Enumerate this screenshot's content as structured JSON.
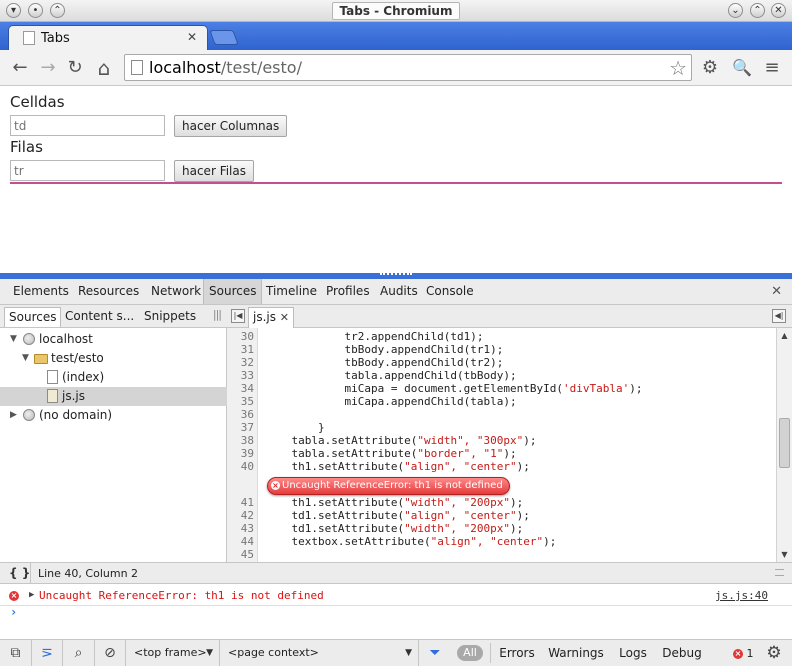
{
  "window": {
    "title": "Tabs - Chromium"
  },
  "tabs": [
    {
      "label": "Tabs",
      "close": "✕"
    }
  ],
  "toolbar": {
    "back": "←",
    "forward": "→",
    "reload": "↻",
    "home": "⌂",
    "url_host": "localhost",
    "url_path": "/test/esto/",
    "star": "☆",
    "settings": "⚙",
    "inspect": "🔍",
    "menu": "≡"
  },
  "page": {
    "celdas_label": "Celldas",
    "celdas_placeholder": "td",
    "columnas_button": "hacer Columnas",
    "filas_label": "Filas",
    "filas_placeholder": "tr",
    "filas_button": "hacer Filas"
  },
  "devtools": {
    "panels": [
      "Elements",
      "Resources",
      "Network",
      "Sources",
      "Timeline",
      "Profiles",
      "Audits",
      "Console"
    ],
    "active_panel": "Sources",
    "close": "✕",
    "navigator_tabs": [
      "Sources",
      "Content s...",
      "Snippets"
    ],
    "navigator_more": "|||",
    "tree": [
      {
        "label": "localhost"
      },
      {
        "label": "test/esto"
      },
      {
        "label": "(index)"
      },
      {
        "label": "js.js"
      },
      {
        "label": "(no domain)"
      }
    ],
    "editor_tab": "js.js",
    "editor_tab_close": "✕",
    "code": [
      {
        "ln": "30",
        "code": "            tr2.appendChild(td1);"
      },
      {
        "ln": "31",
        "code": "            tbBody.appendChild(tr1);"
      },
      {
        "ln": "32",
        "code": "            tbBody.appendChild(tr2);"
      },
      {
        "ln": "33",
        "code": "            tabla.appendChild(tbBody);"
      },
      {
        "ln": "34",
        "pre": "            miCapa = document.getElementById(",
        "str": "'divTabla'",
        "post": ");"
      },
      {
        "ln": "35",
        "code": "            miCapa.appendChild(tabla);"
      },
      {
        "ln": "36",
        "code": ""
      },
      {
        "ln": "37",
        "code": "        }"
      },
      {
        "ln": "38",
        "pre": "    tabla.setAttribute(",
        "str": "\"width\", \"300px\"",
        "post": ");"
      },
      {
        "ln": "39",
        "pre": "    tabla.setAttribute(",
        "str": "\"border\", \"1\"",
        "post": ");"
      },
      {
        "ln": "40",
        "pre": "    th1.setAttribute(",
        "str": "\"align\", \"center\"",
        "post": ");"
      },
      {
        "ln": "41",
        "pre": "    th1.setAttribute(",
        "str": "\"width\", \"200px\"",
        "post": ");"
      },
      {
        "ln": "42",
        "pre": "    td1.setAttribute(",
        "str": "\"align\", \"center\"",
        "post": ");"
      },
      {
        "ln": "43",
        "pre": "    td1.setAttribute(",
        "str": "\"width\", \"200px\"",
        "post": ");"
      },
      {
        "ln": "44",
        "pre": "    textbox.setAttribute(",
        "str": "\"align\", \"center\"",
        "post": ");"
      },
      {
        "ln": "45",
        "code": ""
      }
    ],
    "inline_error": "Uncaught ReferenceError: th1 is not defined",
    "status_position": "Line 40, Column 2",
    "pretty_print": "{ }",
    "console_error": "Uncaught ReferenceError: th1 is not defined",
    "console_source": "js.js:40",
    "console_prompt": "›",
    "bottom": {
      "frame": "<top frame>",
      "context": "<page context>",
      "filter_all": "All",
      "filters": [
        "Errors",
        "Warnings",
        "Logs",
        "Debug"
      ],
      "error_count": "1"
    }
  },
  "colors": {
    "accent": "#3a6fd8",
    "error": "#e03838",
    "hr": "#c2508f"
  }
}
